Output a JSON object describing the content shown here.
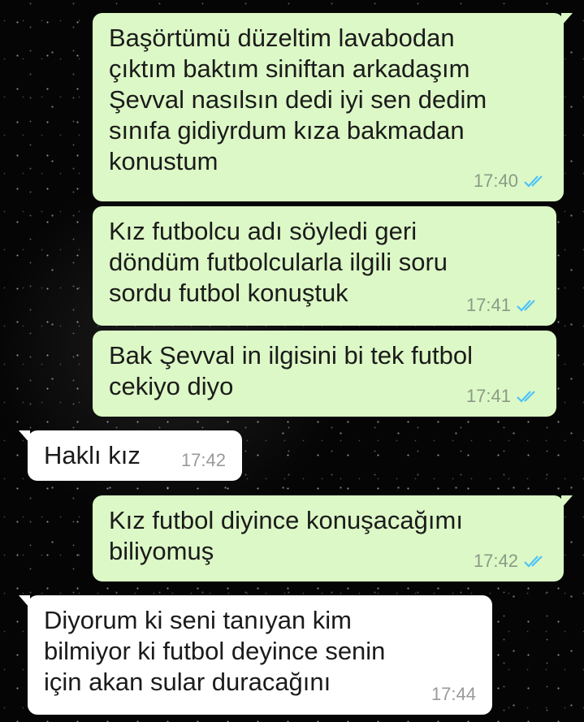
{
  "colors": {
    "outgoing_bubble": "#dcf8c6",
    "incoming_bubble": "#ffffff",
    "read_ticks": "#4fc3f7"
  },
  "messages": [
    {
      "direction": "out",
      "text": "Başörtümü düzeltim lavabodan\nçıktım baktım siniftan arkadaşım\nŞevval nasılsın dedi iyi sen dedim\nsınıfa gidiyrdum kıza bakmadan\nkonustum",
      "time": "17:40",
      "status_icon": "double-check-read-icon"
    },
    {
      "direction": "out",
      "text": "Kız futbolcu adı söyledi geri\ndöndüm futbolcularla ilgili soru\nsordu futbol konuştuk",
      "time": "17:41",
      "status_icon": "double-check-read-icon"
    },
    {
      "direction": "out",
      "text": "Bak Şevval in ilgisini bi tek futbol\ncekiyo diyo",
      "time": "17:41",
      "status_icon": "double-check-read-icon"
    },
    {
      "direction": "in",
      "text": "Haklı kız",
      "time": "17:42"
    },
    {
      "direction": "out",
      "text": "Kız futbol diyince konuşacağımı\nbiliyomuş",
      "time": "17:42",
      "status_icon": "double-check-read-icon"
    },
    {
      "direction": "in",
      "text": "Diyorum ki seni tanıyan kim\nbilmiyor ki futbol deyince senin\niçin akan sular duracağını",
      "time": "17:44"
    }
  ]
}
